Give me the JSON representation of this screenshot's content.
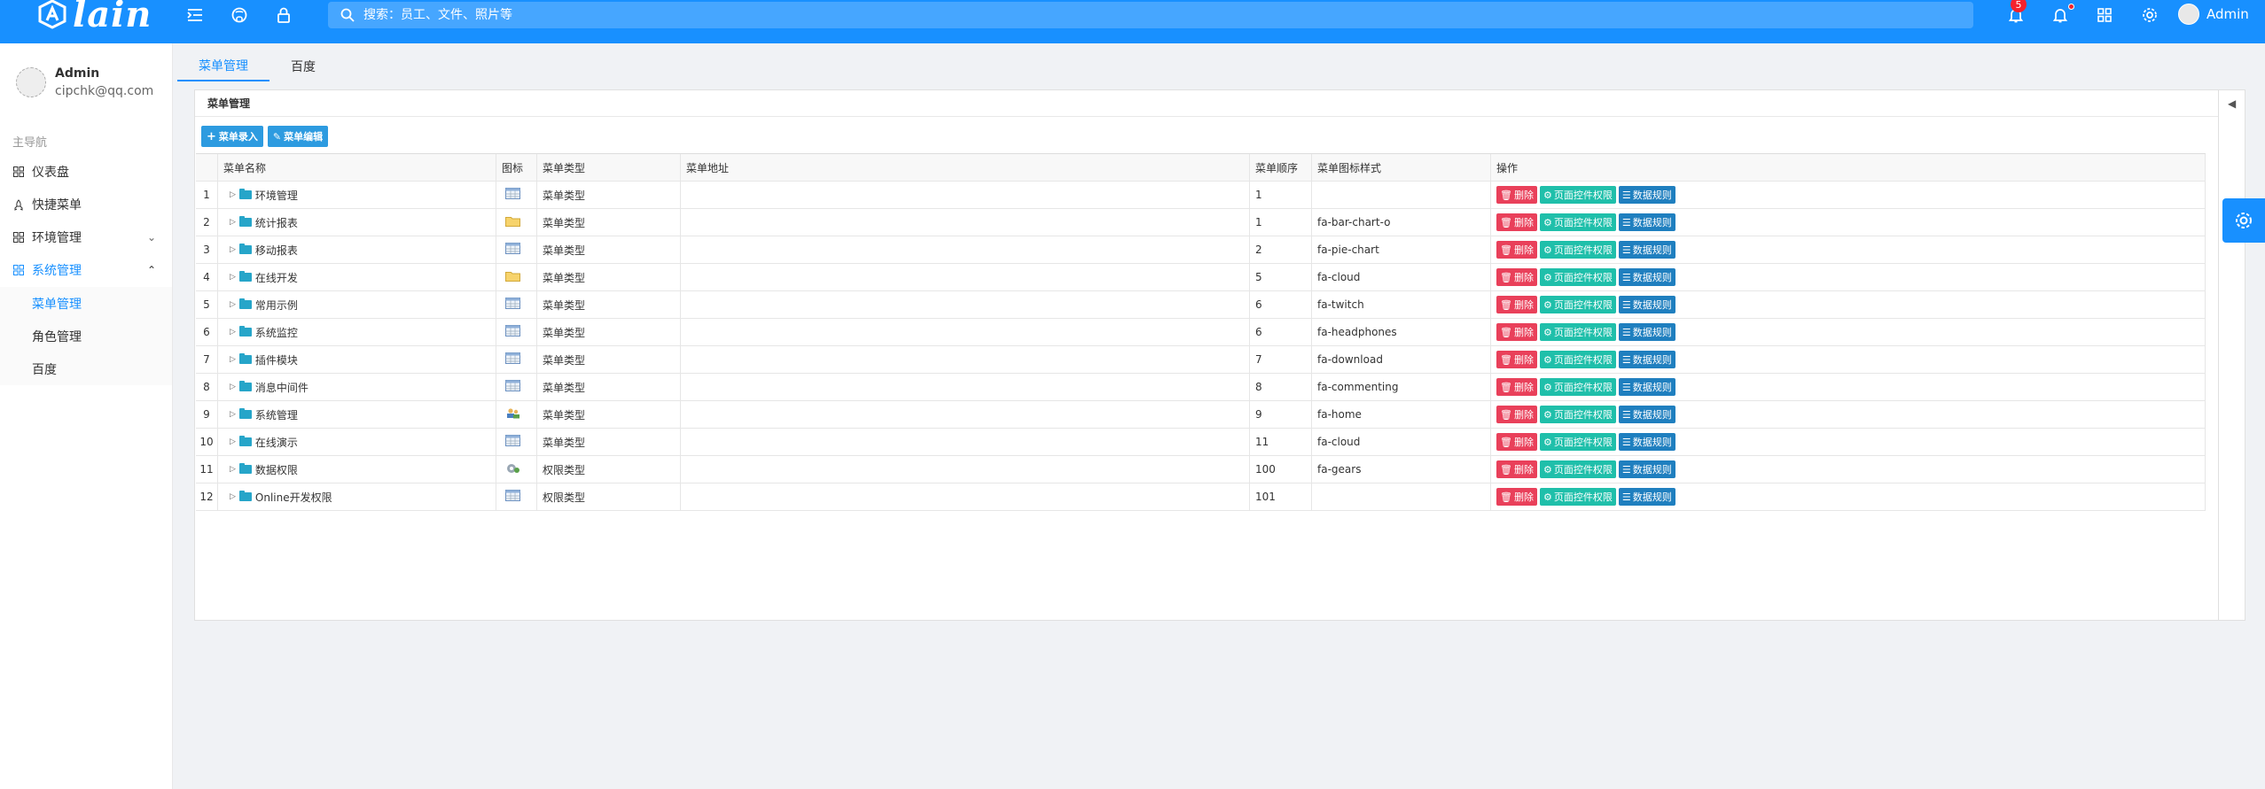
{
  "header": {
    "logo_text": "lain",
    "search_placeholder": "搜索：员工、文件、照片等",
    "notify_count": "5",
    "user_name": "Admin",
    "colors": {
      "primary": "#1890ff"
    }
  },
  "sidebar": {
    "profile": {
      "name": "Admin",
      "email": "cipchk@qq.com"
    },
    "group_title": "主导航",
    "items": [
      {
        "label": "仪表盘",
        "icon": "dashboard-icon"
      },
      {
        "label": "快捷菜单",
        "icon": "rocket-icon"
      },
      {
        "label": "环境管理",
        "icon": "appstore-icon"
      },
      {
        "label": "系统管理",
        "icon": "appstore-icon"
      }
    ],
    "sub_items": [
      "菜单管理",
      "角色管理",
      "百度"
    ]
  },
  "tabs": [
    {
      "label": "菜单管理",
      "active": true
    },
    {
      "label": "百度",
      "active": false
    }
  ],
  "panel": {
    "title": "菜单管理",
    "toolbar": {
      "add_label": "菜单录入",
      "edit_label": "菜单编辑"
    },
    "columns": [
      "",
      "菜单名称",
      "图标",
      "菜单类型",
      "菜单地址",
      "菜单顺序",
      "菜单图标样式",
      "操作"
    ],
    "actions": {
      "delete": "删除",
      "perm": "页面控件权限",
      "data": "数据规则"
    },
    "rows": [
      {
        "no": "1",
        "name": "环境管理",
        "type": "菜单类型",
        "url": "",
        "order": "1",
        "icon_style": "",
        "icon": "table"
      },
      {
        "no": "2",
        "name": "统计报表",
        "type": "菜单类型",
        "url": "",
        "order": "1",
        "icon_style": "fa-bar-chart-o",
        "icon": "folder"
      },
      {
        "no": "3",
        "name": "移动报表",
        "type": "菜单类型",
        "url": "",
        "order": "2",
        "icon_style": "fa-pie-chart",
        "icon": "table"
      },
      {
        "no": "4",
        "name": "在线开发",
        "type": "菜单类型",
        "url": "",
        "order": "5",
        "icon_style": "fa-cloud",
        "icon": "folder"
      },
      {
        "no": "5",
        "name": "常用示例",
        "type": "菜单类型",
        "url": "",
        "order": "6",
        "icon_style": "fa-twitch",
        "icon": "table"
      },
      {
        "no": "6",
        "name": "系统监控",
        "type": "菜单类型",
        "url": "",
        "order": "6",
        "icon_style": "fa-headphones",
        "icon": "table"
      },
      {
        "no": "7",
        "name": "插件模块",
        "type": "菜单类型",
        "url": "",
        "order": "7",
        "icon_style": "fa-download",
        "icon": "table"
      },
      {
        "no": "8",
        "name": "消息中间件",
        "type": "菜单类型",
        "url": "",
        "order": "8",
        "icon_style": "fa-commenting",
        "icon": "table"
      },
      {
        "no": "9",
        "name": "系统管理",
        "type": "菜单类型",
        "url": "",
        "order": "9",
        "icon_style": "fa-home",
        "icon": "users"
      },
      {
        "no": "10",
        "name": "在线演示",
        "type": "菜单类型",
        "url": "",
        "order": "11",
        "icon_style": "fa-cloud",
        "icon": "table"
      },
      {
        "no": "11",
        "name": "数据权限",
        "type": "权限类型",
        "url": "",
        "order": "100",
        "icon_style": "fa-gears",
        "icon": "gear"
      },
      {
        "no": "12",
        "name": "Online开发权限",
        "type": "权限类型",
        "url": "",
        "order": "101",
        "icon_style": "",
        "icon": "table"
      }
    ]
  }
}
